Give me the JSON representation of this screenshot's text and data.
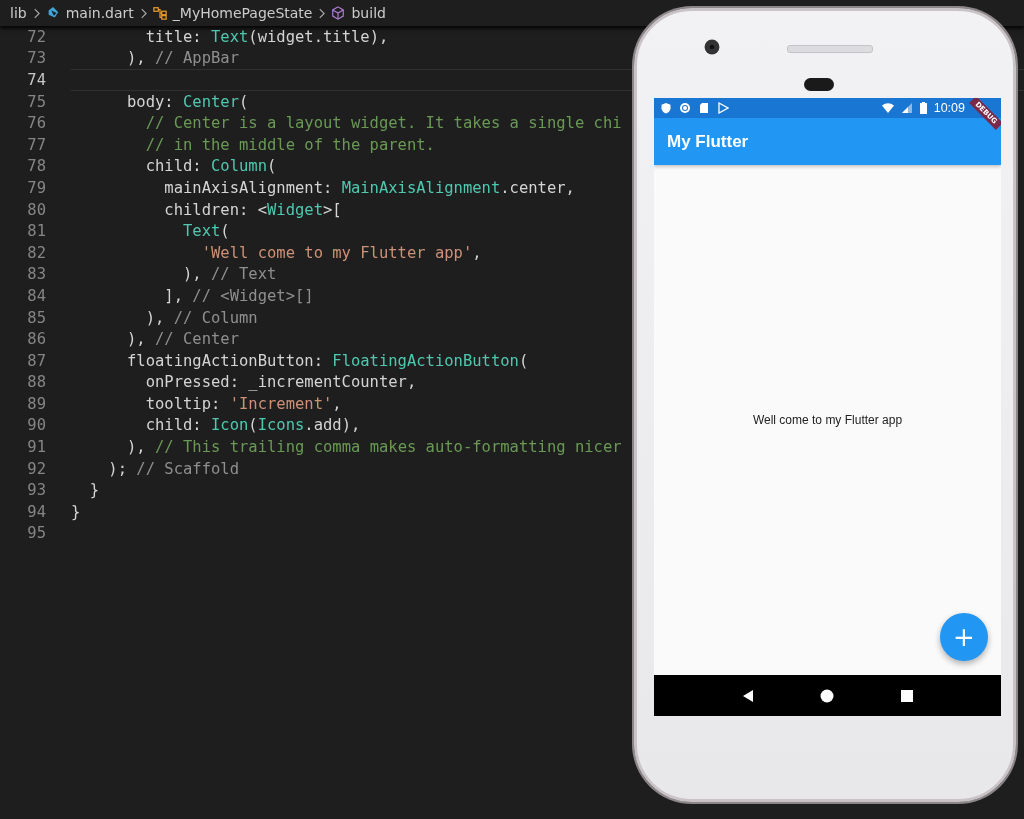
{
  "breadcrumbs": [
    {
      "label": "lib"
    },
    {
      "label": "main.dart"
    },
    {
      "label": "_MyHomePageState"
    },
    {
      "label": "build"
    }
  ],
  "code_lines": [
    {
      "number": "72",
      "current": false,
      "tokens": [
        {
          "kind": "plain",
          "text": "        title: "
        },
        {
          "kind": "type",
          "text": "Text"
        },
        {
          "kind": "plain",
          "text": "(widget.title),"
        }
      ]
    },
    {
      "number": "73",
      "current": false,
      "tokens": [
        {
          "kind": "plain",
          "text": "      ), "
        },
        {
          "kind": "label",
          "text": "// AppBar"
        }
      ]
    },
    {
      "number": "74",
      "current": true
    },
    {
      "number": "75",
      "current": false,
      "tokens": [
        {
          "kind": "plain",
          "text": "      body: "
        },
        {
          "kind": "type",
          "text": "Center"
        },
        {
          "kind": "plain",
          "text": "("
        }
      ]
    },
    {
      "number": "76",
      "current": false,
      "tokens": [
        {
          "kind": "comment",
          "text": "        // Center is a layout widget. It takes a single chi"
        }
      ]
    },
    {
      "number": "77",
      "current": false,
      "tokens": [
        {
          "kind": "comment",
          "text": "        // in the middle of the parent."
        }
      ]
    },
    {
      "number": "78",
      "current": false,
      "tokens": [
        {
          "kind": "plain",
          "text": "        child: "
        },
        {
          "kind": "type",
          "text": "Column"
        },
        {
          "kind": "plain",
          "text": "("
        }
      ]
    },
    {
      "number": "79",
      "current": false,
      "tokens": [
        {
          "kind": "plain",
          "text": "          mainAxisAlignment: "
        },
        {
          "kind": "type",
          "text": "MainAxisAlignment"
        },
        {
          "kind": "plain",
          "text": ".center,"
        }
      ]
    },
    {
      "number": "80",
      "current": false,
      "tokens": [
        {
          "kind": "plain",
          "text": "          children: <"
        },
        {
          "kind": "type",
          "text": "Widget"
        },
        {
          "kind": "plain",
          "text": ">["
        }
      ]
    },
    {
      "number": "81",
      "current": false,
      "tokens": [
        {
          "kind": "type",
          "text": "            Text"
        },
        {
          "kind": "plain",
          "text": "("
        }
      ]
    },
    {
      "number": "82",
      "current": false,
      "tokens": [
        {
          "kind": "string",
          "text": "              'Well come to my Flutter app'"
        },
        {
          "kind": "plain",
          "text": ","
        }
      ]
    },
    {
      "number": "83",
      "current": false,
      "tokens": [
        {
          "kind": "plain",
          "text": "            ), "
        },
        {
          "kind": "label",
          "text": "// Text"
        }
      ]
    },
    {
      "number": "84",
      "current": false,
      "tokens": [
        {
          "kind": "plain",
          "text": "          ], "
        },
        {
          "kind": "label",
          "text": "// <Widget>[]"
        }
      ]
    },
    {
      "number": "85",
      "current": false,
      "tokens": [
        {
          "kind": "plain",
          "text": "        ), "
        },
        {
          "kind": "label",
          "text": "// Column"
        }
      ]
    },
    {
      "number": "86",
      "current": false,
      "tokens": [
        {
          "kind": "plain",
          "text": "      ), "
        },
        {
          "kind": "label",
          "text": "// Center"
        }
      ]
    },
    {
      "number": "87",
      "current": false,
      "tokens": [
        {
          "kind": "plain",
          "text": "      floatingActionButton: "
        },
        {
          "kind": "type",
          "text": "FloatingActionButton"
        },
        {
          "kind": "plain",
          "text": "("
        }
      ]
    },
    {
      "number": "88",
      "current": false,
      "tokens": [
        {
          "kind": "plain",
          "text": "        onPressed: _incrementCounter,"
        }
      ]
    },
    {
      "number": "89",
      "current": false,
      "tokens": [
        {
          "kind": "plain",
          "text": "        tooltip: "
        },
        {
          "kind": "string",
          "text": "'Increment'"
        },
        {
          "kind": "plain",
          "text": ","
        }
      ]
    },
    {
      "number": "90",
      "current": false,
      "tokens": [
        {
          "kind": "plain",
          "text": "        child: "
        },
        {
          "kind": "type",
          "text": "Icon"
        },
        {
          "kind": "plain",
          "text": "("
        },
        {
          "kind": "type",
          "text": "Icons"
        },
        {
          "kind": "plain",
          "text": ".add),"
        }
      ]
    },
    {
      "number": "91",
      "current": false,
      "tokens": [
        {
          "kind": "plain",
          "text": "      ), "
        },
        {
          "kind": "comment",
          "text": "// This trailing comma makes auto-formatting nicer"
        }
      ]
    },
    {
      "number": "92",
      "current": false,
      "tokens": [
        {
          "kind": "plain",
          "text": "    ); "
        },
        {
          "kind": "label",
          "text": "// Scaffold"
        }
      ]
    },
    {
      "number": "93",
      "current": false,
      "tokens": [
        {
          "kind": "plain",
          "text": "  }"
        }
      ]
    },
    {
      "number": "94",
      "current": false,
      "tokens": [
        {
          "kind": "plain",
          "text": "}"
        }
      ]
    },
    {
      "number": "95",
      "current": false
    }
  ],
  "phone": {
    "status_bar": {
      "time": "10:09"
    },
    "debug_banner": "DEBUG",
    "app_bar": {
      "title": "My Flutter"
    },
    "body_text": "Well come to my Flutter app",
    "fab": {
      "symbol": "+"
    }
  }
}
